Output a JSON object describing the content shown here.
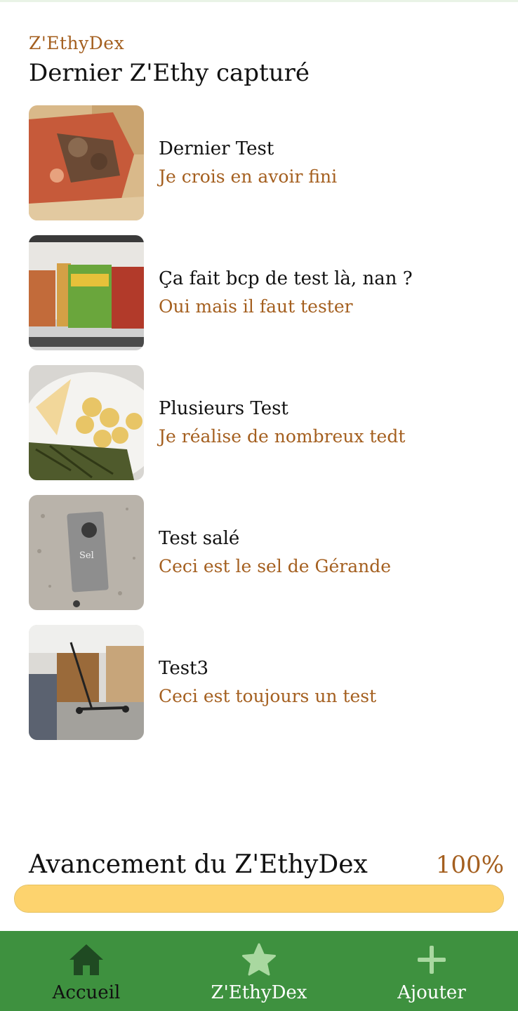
{
  "header": {
    "app_name": "Z'EthyDex",
    "title": "Dernier Z'Ethy capturé"
  },
  "items": [
    {
      "title": "Dernier Test",
      "subtitle": "Je crois en avoir fini",
      "image": "pizza-photo"
    },
    {
      "title": "Ça fait bcp de test là,  nan ?",
      "subtitle": "Oui mais il faut tester",
      "image": "bookshelf-photo"
    },
    {
      "title": "Plusieurs Test",
      "subtitle": "Je réalise de nombreux tedt",
      "image": "food-plate-photo"
    },
    {
      "title": "Test salé",
      "subtitle": "Ceci est le sel de Gérande",
      "image": "salt-packet-photo"
    },
    {
      "title": "Test3",
      "subtitle": "Ceci est toujours un test",
      "image": "room-photo"
    }
  ],
  "progress": {
    "label": "Avancement du Z'EthyDex",
    "value_text": "100%",
    "value": 1.0,
    "fill_color": "#fdd36e"
  },
  "nav": [
    {
      "label": "Accueil",
      "icon": "home-icon",
      "active": true
    },
    {
      "label": "Z'EthyDex",
      "icon": "star-icon",
      "active": false
    },
    {
      "label": "Ajouter",
      "icon": "plus-icon",
      "active": false
    }
  ],
  "colors": {
    "accent": "#a45f1f",
    "nav_bg": "#3e913f",
    "nav_active_icon": "#1f4a22",
    "nav_inactive_icon": "#a9d8a0"
  }
}
